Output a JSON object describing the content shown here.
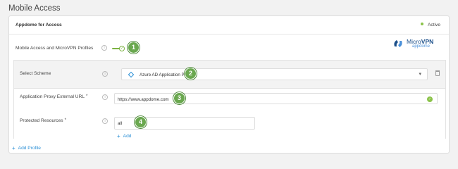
{
  "page": {
    "title": "Mobile Access"
  },
  "card": {
    "title": "Appdome for Access",
    "status": "Active",
    "status_color": "#8bc34a"
  },
  "logo": {
    "brand": "MicroVPN",
    "brand_prefix": "Micro",
    "brand_suffix": "VPN",
    "sub": "appdome"
  },
  "rows": {
    "mobile_access": {
      "label": "Mobile Access and MicroVPN Profiles",
      "enabled": true
    },
    "scheme": {
      "label": "Select Scheme",
      "value": "Azure AD Application Proxy",
      "icon": "azure-diamond-icon"
    },
    "proxy_url": {
      "label": "Application Proxy External URL",
      "required": "*",
      "value": "https://www.appdome.com"
    },
    "protected": {
      "label": "Protected Resources",
      "required": "*",
      "value": "all"
    }
  },
  "actions": {
    "add": "Add",
    "add_profile": "Add Profile"
  },
  "badges": [
    "1",
    "2",
    "3",
    "4"
  ],
  "colors": {
    "accent": "#6aa84f",
    "link": "#2a8fd6"
  }
}
